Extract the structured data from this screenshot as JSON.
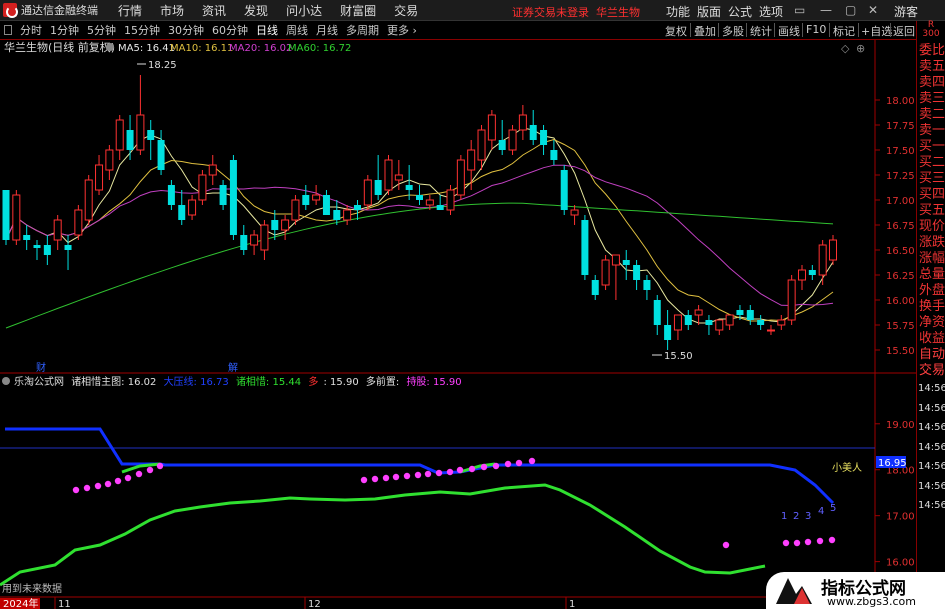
{
  "menubar": {
    "app_title": "通达信金融终端",
    "items": [
      "行情",
      "市场",
      "资讯",
      "发现",
      "问小达",
      "财富圈",
      "交易"
    ],
    "warning": "证券交易未登录",
    "warning_stock": "华兰生物",
    "right_items": [
      "功能",
      "版面",
      "公式",
      "选项"
    ],
    "guest": "游客"
  },
  "toolbar": {
    "periods": [
      "分时",
      "1分钟",
      "5分钟",
      "15分钟",
      "30分钟",
      "60分钟",
      "日线",
      "周线",
      "月线",
      "多周期",
      "更多"
    ],
    "active_period": "日线",
    "right_items": [
      "复权",
      "叠加",
      "多股",
      "统计",
      "画线",
      "F10",
      "标记",
      "+自选",
      "返回"
    ]
  },
  "right_panel": {
    "title_r": "R",
    "title_num": "300",
    "items_top": [
      "委比",
      "卖五",
      "卖四",
      "卖三",
      "卖二",
      "卖一",
      "买一",
      "买二",
      "买三",
      "买四",
      "买五",
      "现价",
      "涨跌",
      "涨幅",
      "总量",
      "外盘",
      "换手",
      "净资",
      "收益",
      "自动",
      "交易"
    ],
    "times": [
      "14:56",
      "14:56",
      "14:56",
      "14:56",
      "14:56",
      "14:56",
      "14:56"
    ]
  },
  "main_chart": {
    "title": "华兰生物(日线 前复权)",
    "ma5_label": "MA5: 16.41",
    "ma10_label": "MA10: 16.11",
    "ma20_label": "MA20: 16.02",
    "ma60_label": "MA60: 16.72",
    "high_label": "18.25",
    "low_label": "15.50",
    "marker_cai": "财",
    "marker_jie": "解",
    "colors": {
      "up": "#ff3232",
      "down": "#00e0e0",
      "ma5": "#e8e8a0",
      "ma10": "#e0c040",
      "ma20": "#c040c0",
      "ma60": "#30c030"
    }
  },
  "sub_chart": {
    "name": "乐淘公式网",
    "items": [
      {
        "label": "诸相惜主图: 16.02",
        "color": "#e0e0e0"
      },
      {
        "label": "大压线: 16.73",
        "color": "#2040ff"
      },
      {
        "label": "诸相惜: 15.44",
        "color": "#30e030"
      },
      {
        "label": "多",
        "color": "#ff3030"
      },
      {
        "label": ": 15.90",
        "color": "#e0e0e0"
      },
      {
        "label": "多前置:",
        "color": "#e0e0e0"
      },
      {
        "label": "持股: 15.90",
        "color": "#ff40ff"
      }
    ],
    "xiaomeiren": "小美人",
    "current_value": "16.95",
    "numbers": [
      "1",
      "2",
      "3",
      "4",
      "5"
    ],
    "no_future": "用到未来数据"
  },
  "date_axis": {
    "year": "2024年",
    "labels": [
      "11",
      "12",
      "1"
    ]
  },
  "main_axis_ticks": [
    "18.00",
    "17.75",
    "17.50",
    "17.25",
    "17.00",
    "16.75",
    "16.50",
    "16.25",
    "16.00",
    "15.75",
    "15.50"
  ],
  "sub_axis_ticks": [
    "19.00",
    "18.00",
    "17.00",
    "16.00"
  ],
  "watermark": {
    "line1": "指标公式网",
    "line2": "www.zbgs3.com"
  },
  "chart_data": {
    "type": "candlestick",
    "title": "华兰生物(日线 前复权)",
    "ylim": [
      15.4,
      18.4
    ],
    "candles_ohlc": [
      [
        17.1,
        17.1,
        16.55,
        16.6
      ],
      [
        16.6,
        17.1,
        16.55,
        17.05
      ],
      [
        16.65,
        16.75,
        16.5,
        16.6
      ],
      [
        16.55,
        16.6,
        16.4,
        16.52
      ],
      [
        16.55,
        16.65,
        16.35,
        16.45
      ],
      [
        16.6,
        16.85,
        16.5,
        16.8
      ],
      [
        16.55,
        16.65,
        16.3,
        16.5
      ],
      [
        16.65,
        16.95,
        16.6,
        16.9
      ],
      [
        16.8,
        17.25,
        16.75,
        17.2
      ],
      [
        17.1,
        17.45,
        17.05,
        17.35
      ],
      [
        17.3,
        17.55,
        17.2,
        17.5
      ],
      [
        17.5,
        17.85,
        17.4,
        17.8
      ],
      [
        17.7,
        17.85,
        17.4,
        17.5
      ],
      [
        17.5,
        18.25,
        17.45,
        17.85
      ],
      [
        17.7,
        17.8,
        17.4,
        17.6
      ],
      [
        17.6,
        17.7,
        17.25,
        17.3
      ],
      [
        17.15,
        17.2,
        16.9,
        16.95
      ],
      [
        16.95,
        17.1,
        16.75,
        16.8
      ],
      [
        16.85,
        17.05,
        16.8,
        17.0
      ],
      [
        17.0,
        17.3,
        16.95,
        17.25
      ],
      [
        17.25,
        17.45,
        17.15,
        17.35
      ],
      [
        17.15,
        17.2,
        16.9,
        16.95
      ],
      [
        17.4,
        17.45,
        16.6,
        16.65
      ],
      [
        16.65,
        16.75,
        16.45,
        16.5
      ],
      [
        16.55,
        16.7,
        16.45,
        16.65
      ],
      [
        16.5,
        16.8,
        16.4,
        16.75
      ],
      [
        16.8,
        16.9,
        16.6,
        16.7
      ],
      [
        16.7,
        16.85,
        16.6,
        16.8
      ],
      [
        16.8,
        17.05,
        16.75,
        17.0
      ],
      [
        17.05,
        17.15,
        16.9,
        16.95
      ],
      [
        17.0,
        17.15,
        16.95,
        17.05
      ],
      [
        17.05,
        17.1,
        16.85,
        16.85
      ],
      [
        16.9,
        17.0,
        16.75,
        16.8
      ],
      [
        16.8,
        16.95,
        16.75,
        16.9
      ],
      [
        16.95,
        17.0,
        16.8,
        16.9
      ],
      [
        16.95,
        17.25,
        16.9,
        17.2
      ],
      [
        17.2,
        17.45,
        17.0,
        17.05
      ],
      [
        17.1,
        17.45,
        17.05,
        17.4
      ],
      [
        17.2,
        17.4,
        17.1,
        17.25
      ],
      [
        17.15,
        17.35,
        17.0,
        17.1
      ],
      [
        17.05,
        17.15,
        16.95,
        17.0
      ],
      [
        16.95,
        17.05,
        16.9,
        17.0
      ],
      [
        16.95,
        17.05,
        16.9,
        16.9
      ],
      [
        16.9,
        17.15,
        16.85,
        17.1
      ],
      [
        17.05,
        17.45,
        17.0,
        17.4
      ],
      [
        17.3,
        17.6,
        17.1,
        17.5
      ],
      [
        17.4,
        17.75,
        17.3,
        17.7
      ],
      [
        17.6,
        17.9,
        17.5,
        17.85
      ],
      [
        17.6,
        17.8,
        17.45,
        17.5
      ],
      [
        17.5,
        17.75,
        17.45,
        17.7
      ],
      [
        17.7,
        17.95,
        17.6,
        17.85
      ],
      [
        17.75,
        17.9,
        17.55,
        17.6
      ],
      [
        17.7,
        17.75,
        17.45,
        17.55
      ],
      [
        17.5,
        17.6,
        17.35,
        17.4
      ],
      [
        17.3,
        17.35,
        16.85,
        16.9
      ],
      [
        16.85,
        16.95,
        16.75,
        16.9
      ],
      [
        16.8,
        16.85,
        16.2,
        16.25
      ],
      [
        16.2,
        16.25,
        16.0,
        16.05
      ],
      [
        16.15,
        16.45,
        16.1,
        16.4
      ],
      [
        16.35,
        16.45,
        16.0,
        16.45
      ],
      [
        16.4,
        16.5,
        16.2,
        16.35
      ],
      [
        16.35,
        16.4,
        16.1,
        16.2
      ],
      [
        16.2,
        16.25,
        16.0,
        16.1
      ],
      [
        16.0,
        16.05,
        15.65,
        15.75
      ],
      [
        15.75,
        15.9,
        15.5,
        15.6
      ],
      [
        15.7,
        15.85,
        15.6,
        15.85
      ],
      [
        15.85,
        15.9,
        15.7,
        15.75
      ],
      [
        15.85,
        15.95,
        15.75,
        15.9
      ],
      [
        15.8,
        15.85,
        15.65,
        15.75
      ],
      [
        15.7,
        15.8,
        15.65,
        15.8
      ],
      [
        15.75,
        15.85,
        15.7,
        15.85
      ],
      [
        15.9,
        15.95,
        15.8,
        15.85
      ],
      [
        15.9,
        15.95,
        15.75,
        15.8
      ],
      [
        15.8,
        15.85,
        15.7,
        15.75
      ],
      [
        15.7,
        15.75,
        15.65,
        15.7
      ],
      [
        15.75,
        15.85,
        15.7,
        15.8
      ],
      [
        15.8,
        16.25,
        15.75,
        16.2
      ],
      [
        16.2,
        16.35,
        16.1,
        16.3
      ],
      [
        16.3,
        16.35,
        16.2,
        16.25
      ],
      [
        16.25,
        16.6,
        16.15,
        16.55
      ],
      [
        16.4,
        16.65,
        16.35,
        16.6
      ]
    ]
  }
}
